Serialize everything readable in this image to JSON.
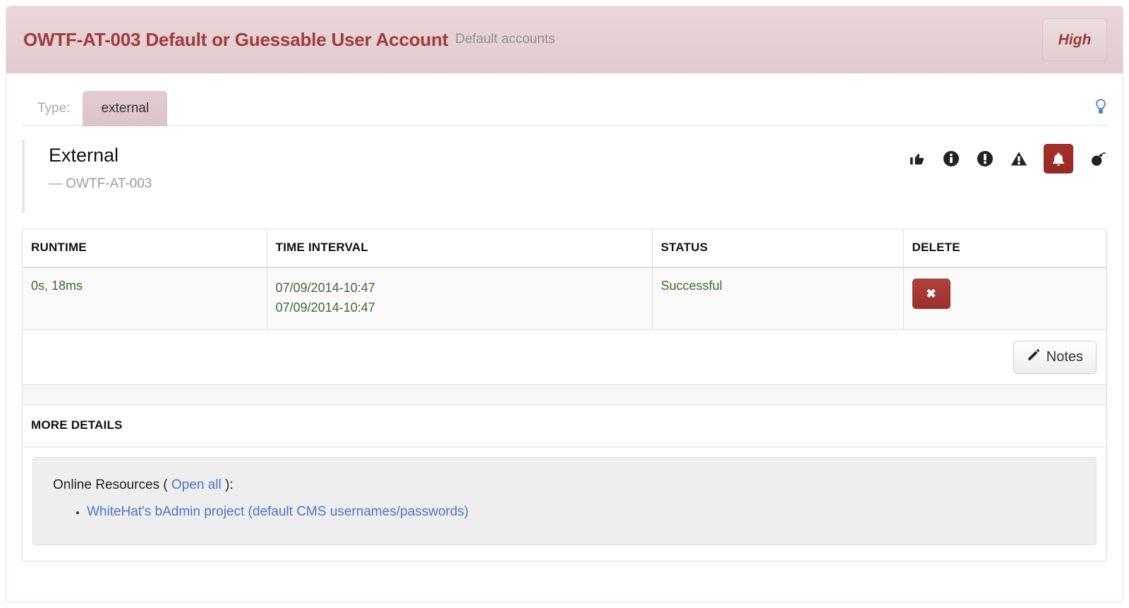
{
  "header": {
    "title": "OWTF-AT-003 Default or Guessable User Account",
    "subtitle": "Default accounts",
    "severity": "High",
    "severity_color": "#9b3a3a",
    "band_color": "#e3ced1"
  },
  "tabs": {
    "label": "Type:",
    "items": [
      {
        "label": "external",
        "active": true
      }
    ],
    "hint_icon": "lightbulb-icon"
  },
  "section": {
    "title": "External",
    "code": "— OWTF-AT-003",
    "rank_icons": [
      {
        "name": "thumbs-up-icon",
        "label": "Passing",
        "active": false
      },
      {
        "name": "info-circle-icon",
        "label": "Info",
        "active": false
      },
      {
        "name": "exclamation-circle-icon",
        "label": "Low",
        "active": false
      },
      {
        "name": "warning-triangle-icon",
        "label": "Medium",
        "active": false
      },
      {
        "name": "bell-icon",
        "label": "High",
        "active": true
      },
      {
        "name": "bomb-icon",
        "label": "Critical",
        "active": false
      }
    ],
    "active_accent": "#9b2f2c"
  },
  "table": {
    "columns": [
      "RUNTIME",
      "TIME INTERVAL",
      "STATUS",
      "DELETE"
    ],
    "rows": [
      {
        "runtime": "0s, 18ms",
        "time_start": "07/09/2014-10:47",
        "time_end": "07/09/2014-10:47",
        "status": "Successful",
        "delete_label": "✖"
      }
    ],
    "value_color": "#3f6b33"
  },
  "notes": {
    "label": "Notes",
    "icon": "pencil-icon"
  },
  "more_details": {
    "heading": "MORE DETAILS",
    "resources_prefix": "Online Resources (",
    "open_all_label": "Open all",
    "resources_suffix": "):",
    "links": [
      "WhiteHat's bAdmin project (default CMS usernames/passwords)"
    ],
    "link_color": "#4a77c4"
  }
}
